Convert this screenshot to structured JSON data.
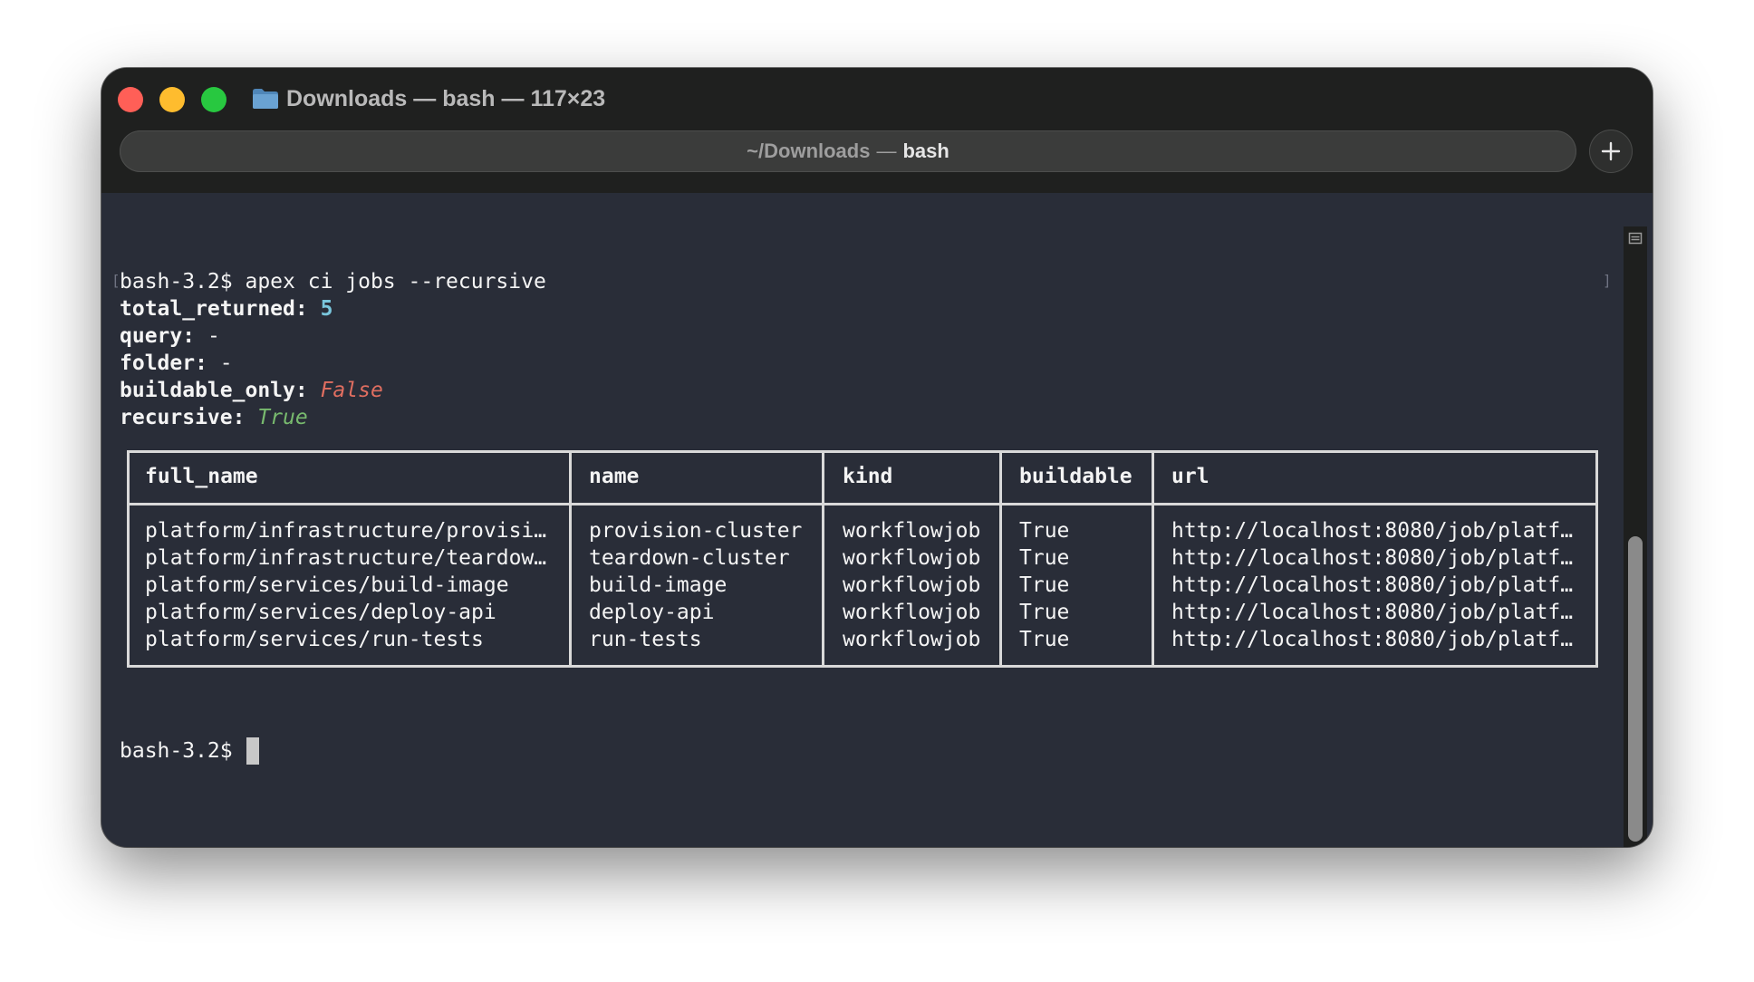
{
  "window": {
    "title": "Downloads — bash — 117×23",
    "tab": {
      "path": "~/Downloads",
      "separator": "—",
      "process": "bash"
    }
  },
  "terminal": {
    "prompt": "bash-3.2$",
    "command": "apex ci jobs --recursive",
    "fields": [
      {
        "key": "total_returned:",
        "value": "5"
      },
      {
        "key": "query:",
        "value": "-"
      },
      {
        "key": "folder:",
        "value": "-"
      },
      {
        "key": "buildable_only:",
        "value": "False"
      },
      {
        "key": "recursive:",
        "value": "True"
      }
    ],
    "table": {
      "headers": [
        "full_name",
        "name",
        "kind",
        "buildable",
        "url"
      ],
      "rows": [
        [
          "platform/infrastructure/provisi…",
          "provision-cluster",
          "workflowjob",
          "True",
          "http://localhost:8080/job/platf…"
        ],
        [
          "platform/infrastructure/teardow…",
          "teardown-cluster",
          "workflowjob",
          "True",
          "http://localhost:8080/job/platf…"
        ],
        [
          "platform/services/build-image",
          "build-image",
          "workflowjob",
          "True",
          "http://localhost:8080/job/platf…"
        ],
        [
          "platform/services/deploy-api",
          "deploy-api",
          "workflowjob",
          "True",
          "http://localhost:8080/job/platf…"
        ],
        [
          "platform/services/run-tests",
          "run-tests",
          "workflowjob",
          "True",
          "http://localhost:8080/job/platf…"
        ]
      ]
    },
    "final_prompt": "bash-3.2$"
  },
  "colors": {
    "terminal_bg": "#292d38",
    "titlebar_bg": "#1f201f",
    "number_value": "#79c6dc",
    "false_value": "#e06e60",
    "true_value": "#78ba6e"
  },
  "icons": [
    "close-button",
    "minimize-button",
    "zoom-button",
    "folder-icon",
    "plus-icon",
    "scroll-marker-icon"
  ]
}
